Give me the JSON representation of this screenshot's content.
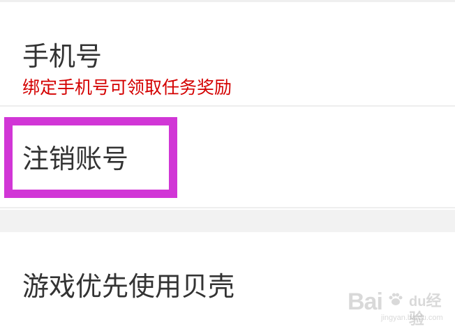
{
  "settings": {
    "phone": {
      "title": "手机号",
      "subtitle": "绑定手机号可领取任务奖励",
      "subtitle_color": "#d40000"
    },
    "cancel_account": {
      "title": "注销账号",
      "highlight_color": "#d136d6"
    },
    "game_priority": {
      "title": "游戏优先使用贝壳"
    }
  },
  "watermark": {
    "logo": "Bai",
    "logo_suffix": "du",
    "cn_text": "经验",
    "url": "jingyan.baidu.com"
  }
}
